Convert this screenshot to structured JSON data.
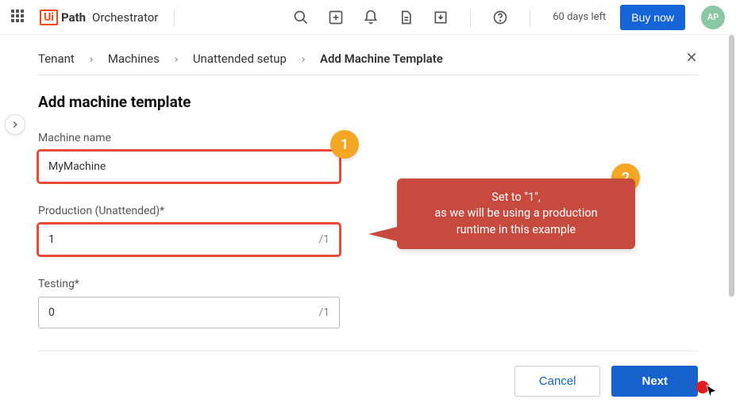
{
  "header": {
    "brand_prefix": "Ui",
    "brand_suffix": "Path",
    "product": "Orchestrator",
    "trial_text": "60 days left",
    "buy_label": "Buy now",
    "avatar_initials": "AP"
  },
  "breadcrumb": {
    "items": [
      "Tenant",
      "Machines",
      "Unattended setup",
      "Add Machine Template"
    ]
  },
  "page": {
    "title": "Add machine template"
  },
  "fields": {
    "machine_name": {
      "label": "Machine name",
      "value": "MyMachine"
    },
    "production": {
      "label": "Production (Unattended)*",
      "value": "1",
      "suffix": "/1"
    },
    "testing": {
      "label": "Testing*",
      "value": "0",
      "suffix": "/1"
    }
  },
  "footer": {
    "cancel": "Cancel",
    "next": "Next"
  },
  "annotations": {
    "badge1": "1",
    "badge2": "2",
    "callout_line1": "Set to \"1\",",
    "callout_line2": "as we will be using a production",
    "callout_line3": "runtime in this example"
  }
}
